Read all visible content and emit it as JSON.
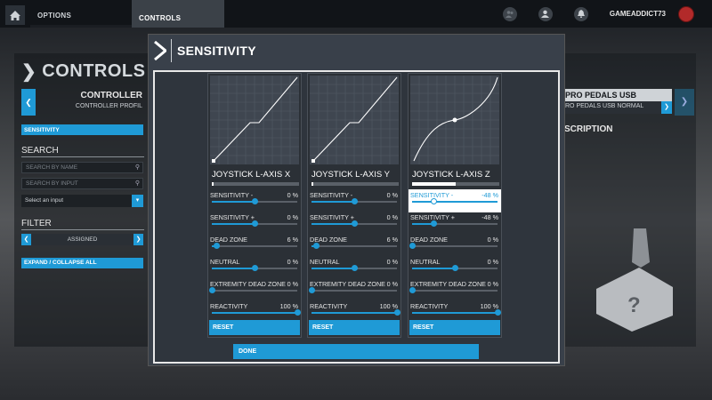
{
  "topbar": {
    "tabs": [
      {
        "label": "OPTIONS"
      },
      {
        "label": "CONTROLS"
      }
    ],
    "username": "GAMEADDICT73"
  },
  "background": {
    "page_title": "CONTROLS",
    "controller_label": "CONTROLLER",
    "controller_profile": "CONTROLLER PROFIL",
    "sensitivity_pill": "SENSITIVITY",
    "search_heading": "SEARCH",
    "search_by_name": "SEARCH BY NAME",
    "search_by_input": "SEARCH BY INPUT",
    "select_input": "Select an input",
    "filter_heading": "FILTER",
    "filter_value": "ASSIGNED",
    "expand_collapse": "EXPAND / COLLAPSE ALL",
    "device_name": "PRO PEDALS USB",
    "device_profile": "RO PEDALS USB NORMAL",
    "description_heading": "SCRIPTION"
  },
  "modal": {
    "title": "SENSITIVITY",
    "done_label": "DONE",
    "axes": [
      {
        "label": "JOYSTICK L-AXIS X",
        "axis_position": 0.0,
        "curve": "linear-deadzone",
        "settings": [
          {
            "label": "SENSITIVITY -",
            "value": "0 %",
            "level": 0.5
          },
          {
            "label": "SENSITIVITY +",
            "value": "0 %",
            "level": 0.5
          },
          {
            "label": "DEAD ZONE",
            "value": "6 %",
            "level": 0.06
          },
          {
            "label": "NEUTRAL",
            "value": "0 %",
            "level": 0.5
          },
          {
            "label": "EXTREMITY DEAD ZONE",
            "value": "0 %",
            "level": 0.0
          },
          {
            "label": "REACTIVITY",
            "value": "100 %",
            "level": 1.0
          }
        ],
        "reset_label": "RESET"
      },
      {
        "label": "JOYSTICK L-AXIS Y",
        "axis_position": 0.0,
        "curve": "linear-deadzone",
        "settings": [
          {
            "label": "SENSITIVITY -",
            "value": "0 %",
            "level": 0.5
          },
          {
            "label": "SENSITIVITY +",
            "value": "0 %",
            "level": 0.5
          },
          {
            "label": "DEAD ZONE",
            "value": "6 %",
            "level": 0.06
          },
          {
            "label": "NEUTRAL",
            "value": "0 %",
            "level": 0.5
          },
          {
            "label": "EXTREMITY DEAD ZONE",
            "value": "0 %",
            "level": 0.0
          },
          {
            "label": "REACTIVITY",
            "value": "100 %",
            "level": 1.0
          }
        ],
        "reset_label": "RESET"
      },
      {
        "label": "JOYSTICK L-AXIS Z",
        "axis_position": 0.5,
        "curve": "s-curve",
        "settings": [
          {
            "label": "SENSITIVITY -",
            "value": "-48 %",
            "level": 0.26,
            "highlighted": true
          },
          {
            "label": "SENSITIVITY +",
            "value": "-48 %",
            "level": 0.26
          },
          {
            "label": "DEAD ZONE",
            "value": "0 %",
            "level": 0.0
          },
          {
            "label": "NEUTRAL",
            "value": "0 %",
            "level": 0.5
          },
          {
            "label": "EXTREMITY DEAD ZONE",
            "value": "0 %",
            "level": 0.0
          },
          {
            "label": "REACTIVITY",
            "value": "100 %",
            "level": 1.0
          }
        ],
        "reset_label": "RESET"
      }
    ]
  },
  "colors": {
    "accent": "#1f9ad6",
    "modal_bg": "#39404a",
    "card_bg": "#2b3036"
  }
}
